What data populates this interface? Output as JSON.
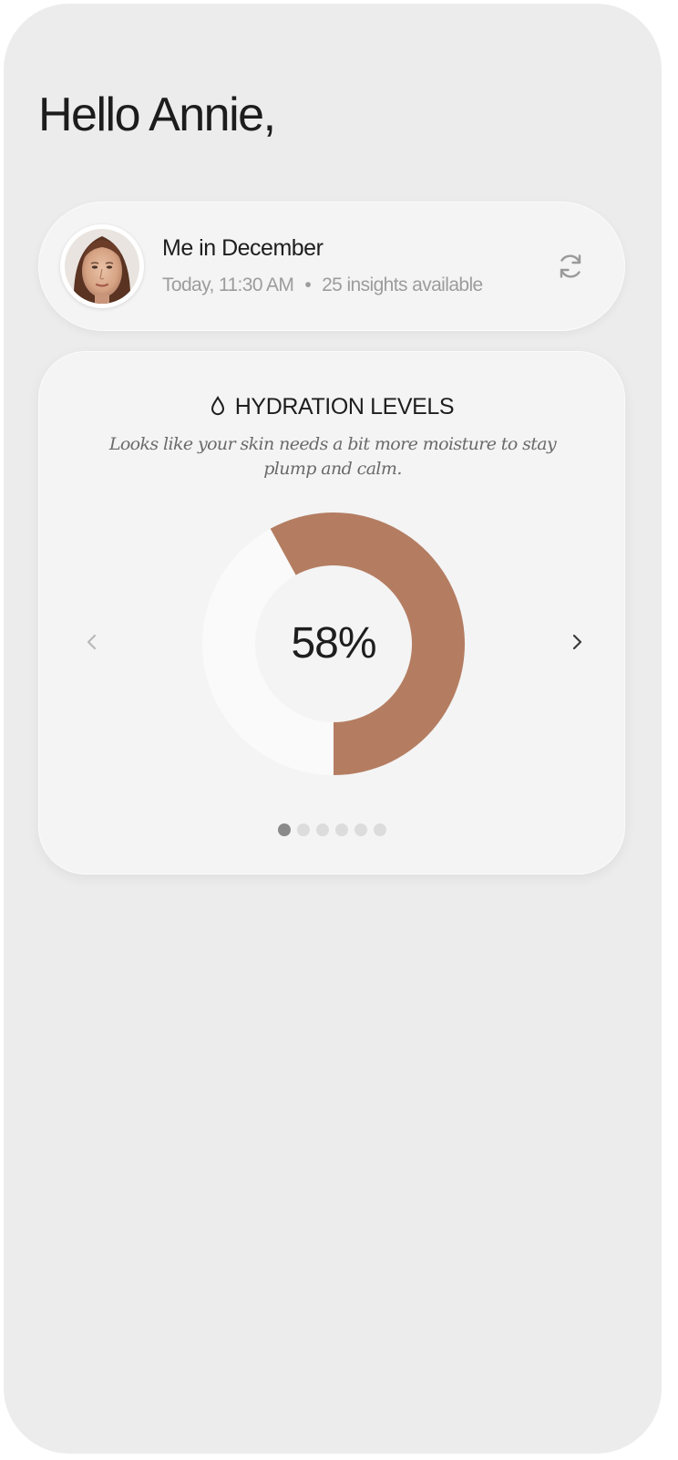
{
  "greeting": "Hello Annie,",
  "profile_card": {
    "title": "Me in December",
    "timestamp": "Today, 11:30 AM",
    "separator": "•",
    "insights": "25 insights available",
    "refresh_icon": "refresh-icon",
    "avatar_icon": "user-portrait"
  },
  "hydration_card": {
    "icon": "water-drop-icon",
    "heading": "HYDRATION LEVELS",
    "description": "Looks like your skin needs a bit more moisture to stay plump and calm.",
    "value_label": "58%",
    "prev_icon": "chevron-left-icon",
    "next_icon": "chevron-right-icon",
    "page_count": 6,
    "active_page": 0
  },
  "chart_data": {
    "type": "pie",
    "variant": "donut",
    "segments": [
      {
        "value": 58,
        "color": "#b47d62"
      },
      {
        "value": 42,
        "color": "#fafafa"
      }
    ],
    "center_label": "58%"
  },
  "colors": {
    "background": "#ececec",
    "card": "#f4f4f4",
    "accent": "#b47d62",
    "text": "#1e1e1e",
    "muted": "#9c9c9c",
    "dot_active": "#8a8a8a",
    "dot_inactive": "#dcdcdc"
  }
}
